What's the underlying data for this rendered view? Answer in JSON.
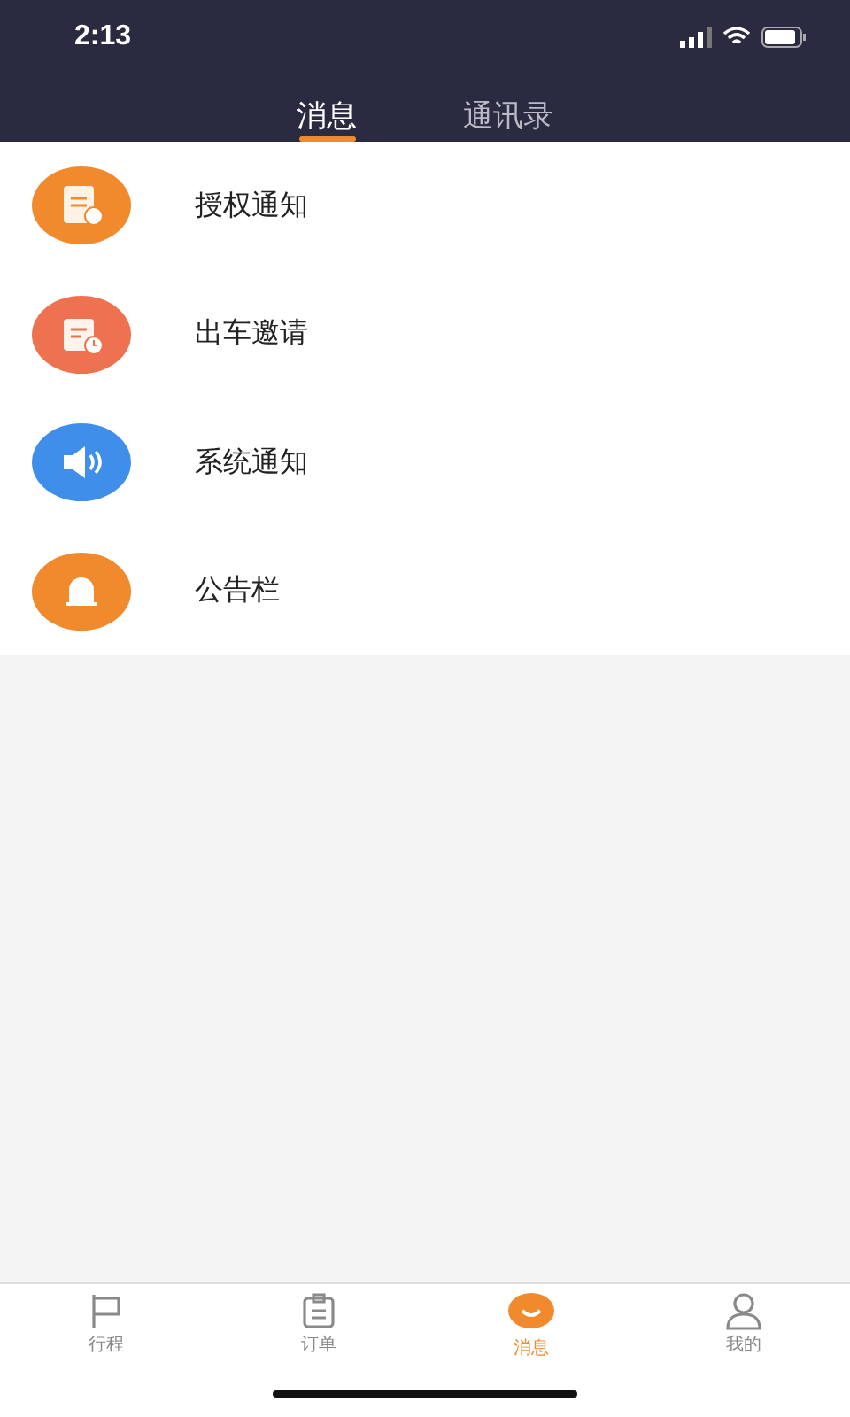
{
  "status_bar": {
    "time": "2:13"
  },
  "tabs": [
    {
      "label": "消息",
      "selected": true
    },
    {
      "label": "通讯录",
      "selected": false
    }
  ],
  "messages": [
    {
      "kind": "authorization",
      "title": "授权通知",
      "color": "#f08a2c"
    },
    {
      "kind": "invitation",
      "title": "出车邀请",
      "color": "#ef7250"
    },
    {
      "kind": "system",
      "title": "系统通知",
      "color": "#3f8eea"
    },
    {
      "kind": "bulletin",
      "title": "公告栏",
      "color": "#f08a2c"
    }
  ],
  "bottom_nav": [
    {
      "kind": "trip",
      "label": "行程",
      "selected": false
    },
    {
      "kind": "order",
      "label": "订单",
      "selected": false
    },
    {
      "kind": "message",
      "label": "消息",
      "selected": true
    },
    {
      "kind": "profile",
      "label": "我的",
      "selected": false
    }
  ]
}
